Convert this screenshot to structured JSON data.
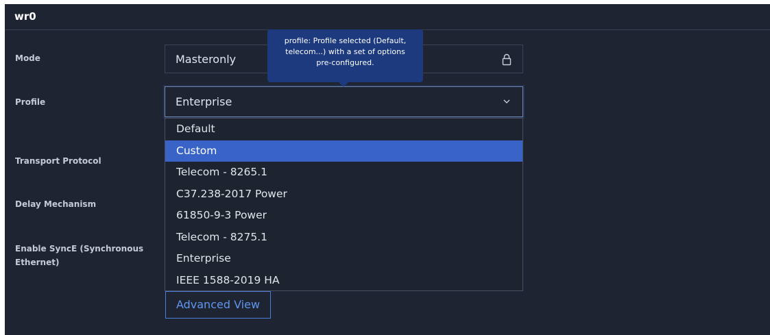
{
  "panel": {
    "title": "wr0"
  },
  "labels": {
    "mode": "Mode",
    "profile": "Profile",
    "transport_protocol": "Transport Protocol",
    "delay_mechanism": "Delay Mechanism",
    "synce_line1": "Enable SyncE (Synchronous",
    "synce_line2": "Ethernet)"
  },
  "mode_field": {
    "value": "Masteronly",
    "icon": "lock-icon",
    "locked": true
  },
  "profile_field": {
    "value": "Enterprise",
    "icon": "chevron-down-icon"
  },
  "tooltip": {
    "text": "profile: Profile selected (Default, telecom...) with a set of options pre-configured."
  },
  "dropdown": {
    "highlighted": "Custom",
    "options": [
      "Default",
      "Custom",
      "Telecom - 8265.1",
      "C37.238-2017 Power",
      "61850-9-3 Power",
      "Telecom - 8275.1",
      "Enterprise",
      "IEEE 1588-2019 HA"
    ]
  },
  "buttons": {
    "advanced_view": "Advanced View"
  },
  "colors": {
    "background": "#1f2433",
    "highlight": "#3a63c7",
    "tooltip": "#1d3a7e",
    "link": "#5e96f0"
  }
}
